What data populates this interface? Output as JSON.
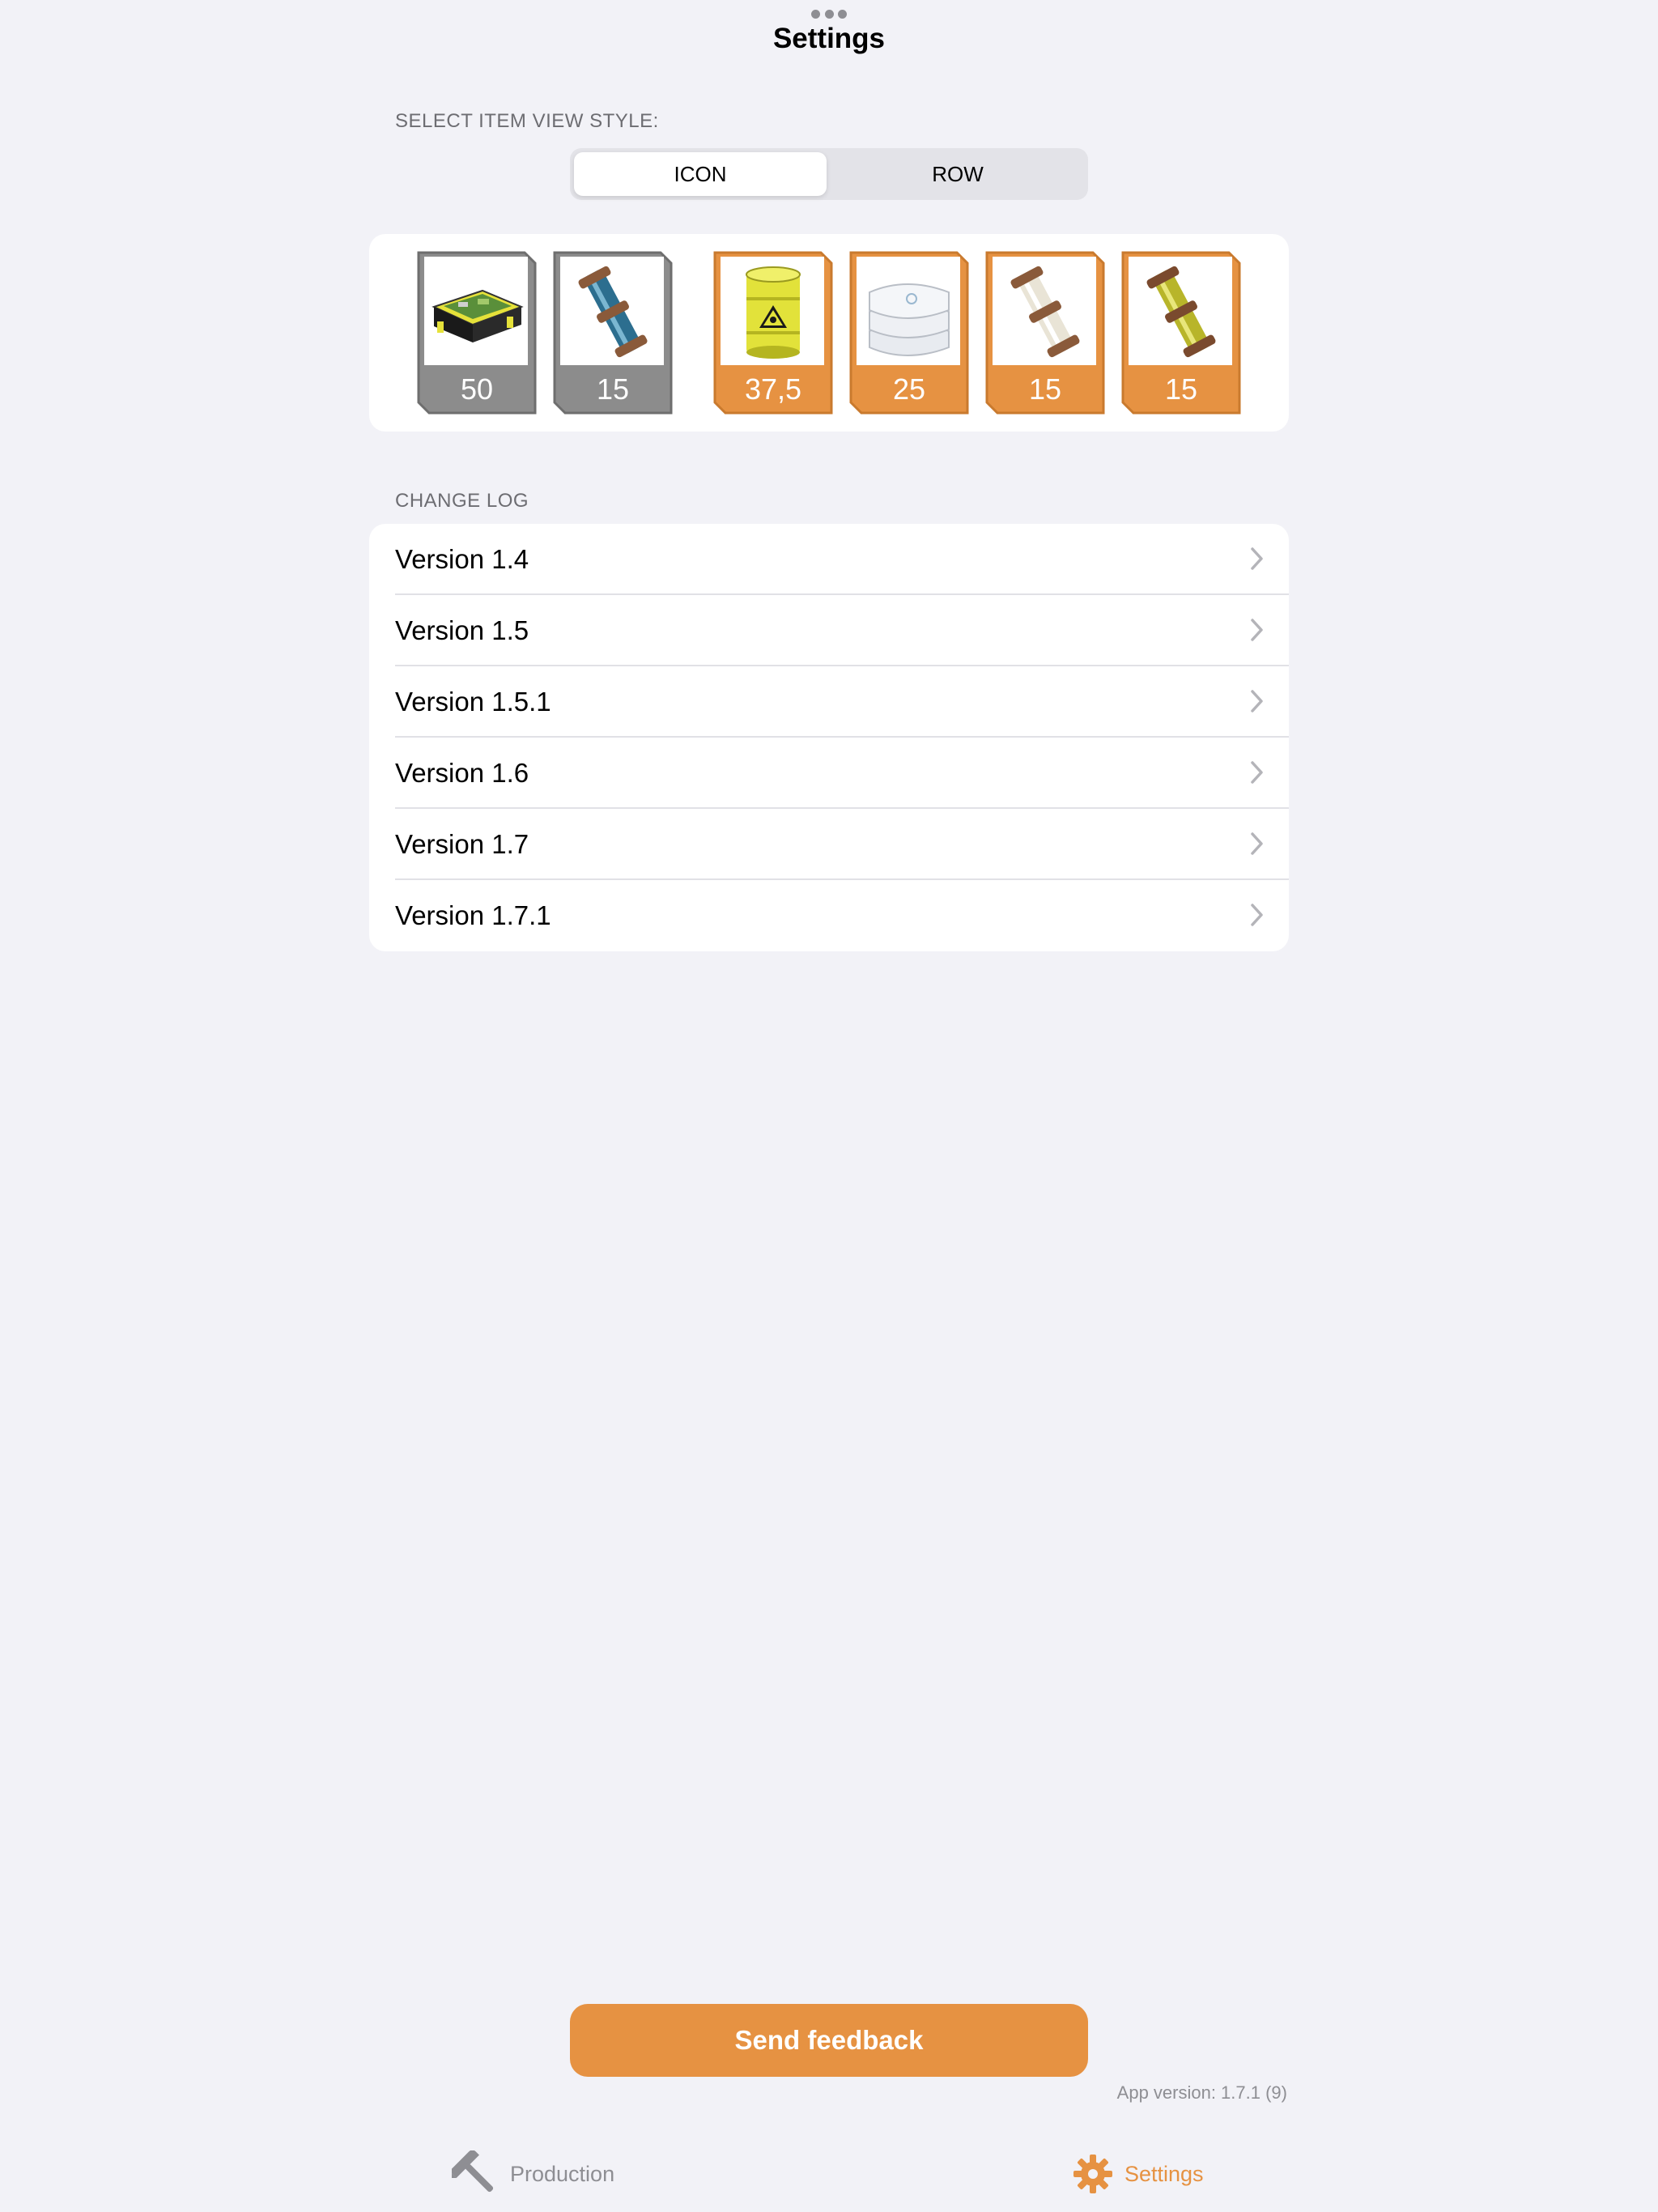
{
  "header": {
    "title": "Settings"
  },
  "view_style": {
    "label": "SELECT ITEM VIEW STYLE:",
    "options": [
      "ICON",
      "ROW"
    ],
    "selected": "ICON"
  },
  "preview_items": [
    {
      "count": "50",
      "color": "#8c8c8c",
      "icon": "circuit-board-crate-icon"
    },
    {
      "count": "15",
      "color": "#8c8c8c",
      "icon": "blue-capsule-icon"
    },
    {
      "count": "37,5",
      "color": "#e69242",
      "icon": "radioactive-barrel-icon"
    },
    {
      "count": "25",
      "color": "#e69242",
      "icon": "white-sacks-icon"
    },
    {
      "count": "15",
      "color": "#e69242",
      "icon": "white-capsule-icon"
    },
    {
      "count": "15",
      "color": "#e69242",
      "icon": "yellow-capsule-icon"
    }
  ],
  "changelog": {
    "label": "CHANGE LOG",
    "items": [
      "Version 1.4",
      "Version 1.5",
      "Version 1.5.1",
      "Version 1.6",
      "Version 1.7",
      "Version 1.7.1"
    ]
  },
  "feedback": {
    "label": "Send feedback"
  },
  "app_version": "App version: 1.7.1 (9)",
  "tabbar": {
    "production": {
      "label": "Production",
      "icon": "hammer-icon"
    },
    "settings": {
      "label": "Settings",
      "icon": "gear-icon",
      "active": true
    }
  },
  "colors": {
    "accent": "#e69242",
    "grey_frame": "#8c8c8c",
    "background": "#f2f2f7"
  }
}
